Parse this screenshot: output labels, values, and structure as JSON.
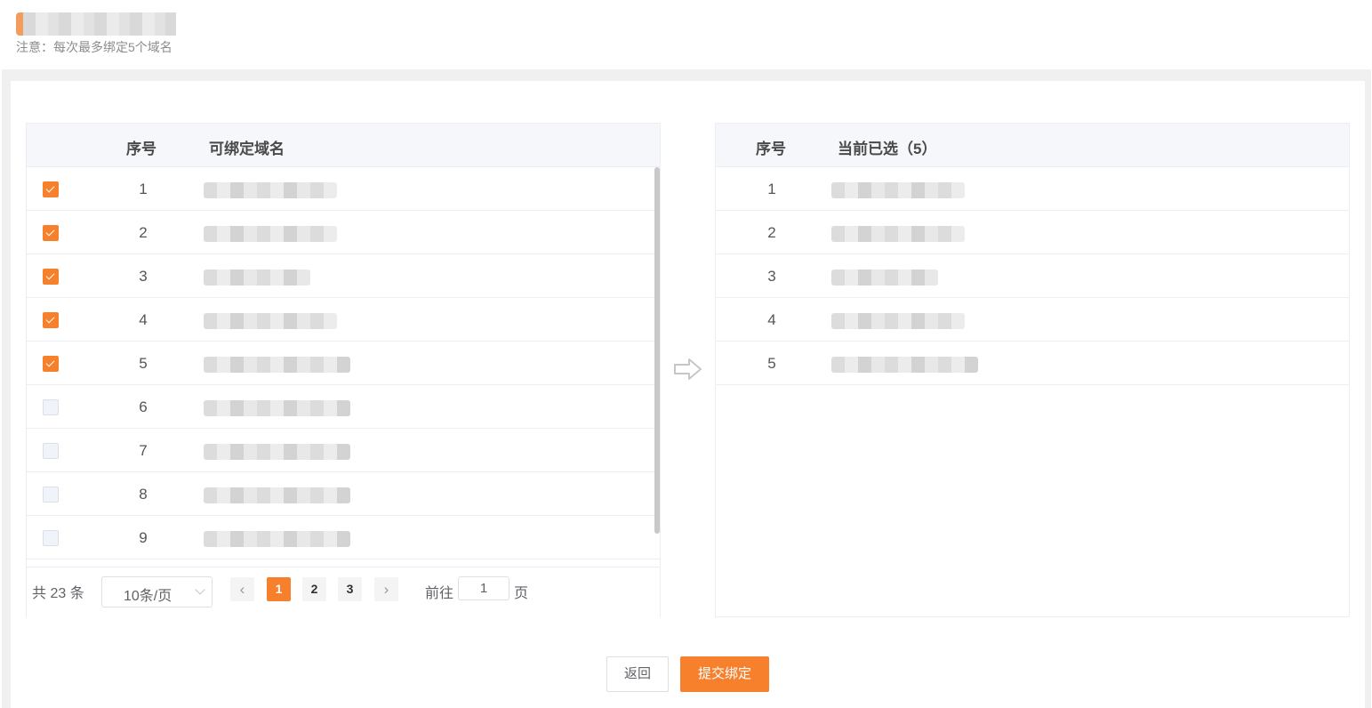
{
  "header": {
    "note": "注意：每次最多绑定5个域名"
  },
  "left_table": {
    "columns": [
      "序号",
      "可绑定域名"
    ],
    "rows": [
      {
        "index": "1",
        "checked": true
      },
      {
        "index": "2",
        "checked": true
      },
      {
        "index": "3",
        "checked": true
      },
      {
        "index": "4",
        "checked": true
      },
      {
        "index": "5",
        "checked": true
      },
      {
        "index": "6",
        "checked": false
      },
      {
        "index": "7",
        "checked": false
      },
      {
        "index": "8",
        "checked": false
      },
      {
        "index": "9",
        "checked": false
      }
    ]
  },
  "right_table": {
    "columns": [
      "序号",
      "当前已选（5）"
    ],
    "rows": [
      {
        "index": "1"
      },
      {
        "index": "2"
      },
      {
        "index": "3"
      },
      {
        "index": "4"
      },
      {
        "index": "5"
      }
    ]
  },
  "pagination": {
    "total": "共 23 条",
    "page_size": "10条/页",
    "pages": [
      "1",
      "2",
      "3"
    ],
    "current_page": "1",
    "prev_icon": "chevron-left-icon",
    "next_icon": "chevron-right-icon",
    "goto_prefix": "前往",
    "goto_value": "1",
    "goto_suffix": "页"
  },
  "actions": {
    "back_label": "返回",
    "submit_label": "提交绑定"
  },
  "colors": {
    "accent": "#f7802c"
  }
}
